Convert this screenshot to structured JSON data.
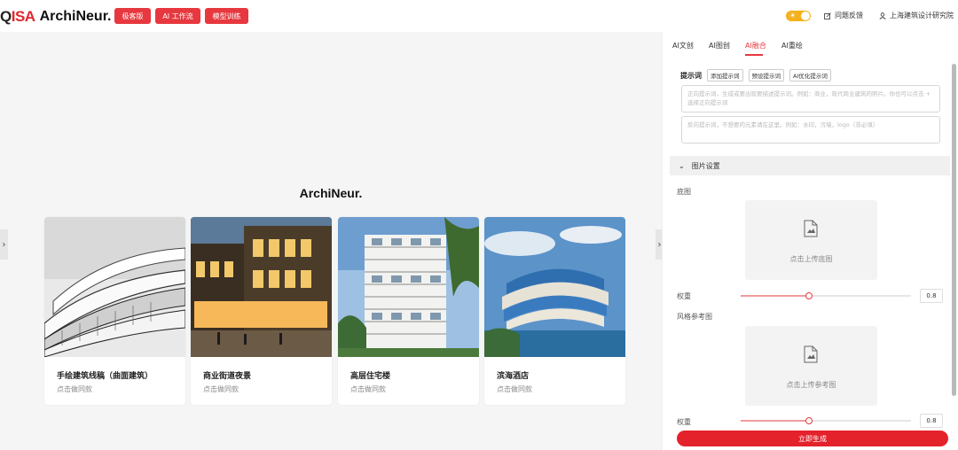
{
  "header": {
    "logo_mark": "QISA",
    "logo_text": "ArchiNeur.",
    "buttons": [
      "极客版",
      "AI 工作流",
      "模型训练"
    ],
    "feedback": "问题反馈",
    "institute": "上海建筑设计研究院",
    "accent": "#e7383f"
  },
  "main": {
    "title": "ArchiNeur.",
    "cards": [
      {
        "name": "手绘建筑线稿（曲面建筑）",
        "sub": "点击做同款"
      },
      {
        "name": "商业街道夜景",
        "sub": "点击做同款"
      },
      {
        "name": "高层住宅楼",
        "sub": "点击做同款"
      },
      {
        "name": "滨海酒店",
        "sub": "点击做同款"
      }
    ]
  },
  "sidebar": {
    "tabs": [
      "AI文创",
      "AI图创",
      "AI融合",
      "AI重绘"
    ],
    "active_tab": "AI融合",
    "prompt": {
      "label": "提示词",
      "chips": [
        "添加提示词",
        "预设提示词",
        "AI优化提示词"
      ],
      "positive_placeholder": "正向提示词，生成或要出现要描述提示词。例如：商业，现代商业建筑的照片。你也可以点击 + 选择正向提示词",
      "negative_placeholder": "反向提示词，不想要的元素请在这里。例如：水印，污墙，logo（非必填）"
    },
    "image_settings": {
      "title": "图片设置",
      "base_label": "底图",
      "base_upload": "点击上传底图",
      "weight_label": "权重",
      "weight1": "0.8",
      "weight1_level": 0.4,
      "style_label": "风格参考图",
      "style_upload": "点击上传参考图",
      "weight2": "0.8",
      "weight2_level": 0.4
    },
    "generate": "立即生成"
  }
}
